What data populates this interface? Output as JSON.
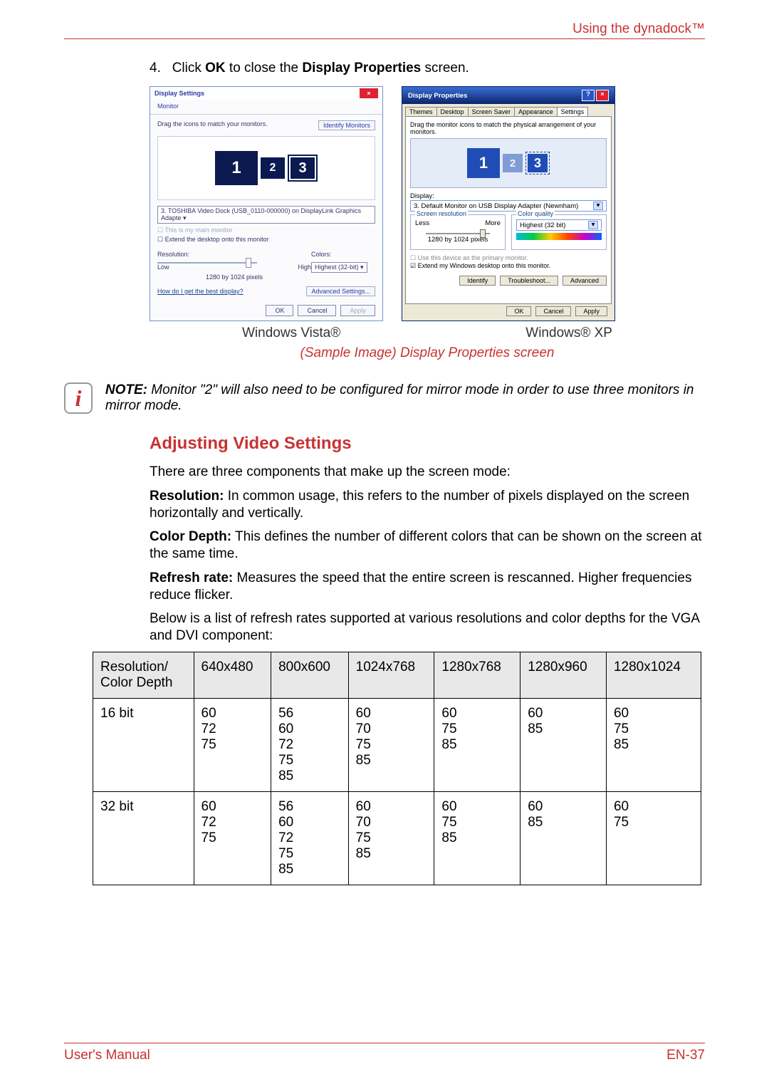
{
  "header": {
    "right": "Using the dynadock™"
  },
  "step": {
    "num": "4.",
    "text_pre": "Click ",
    "bold1": "OK",
    "mid": " to close the ",
    "bold2": "Display Properties",
    "text_post": " screen."
  },
  "vista": {
    "title": "Display Settings",
    "sub": "Monitor",
    "arrange_text": "Drag the icons to match your monitors.",
    "identify": "Identify Monitors",
    "m1": "1",
    "m2": "2",
    "m3": "3",
    "device_dd": "3. TOSHIBA Video Dock (USB_0110-000000) on DisplayLink Graphics Adapte  ▾",
    "cb_main": "This is my main monitor",
    "cb_extend": "Extend the desktop onto this monitor",
    "res_label": "Resolution:",
    "colors_label": "Colors:",
    "low": "Low",
    "high": "High",
    "colors_val": "Highest (32-bit)   ▾",
    "res_val": "1280 by 1024 pixels",
    "help": "How do I get the best display?",
    "adv": "Advanced Settings...",
    "ok": "OK",
    "cancel": "Cancel",
    "apply": "Apply"
  },
  "xp": {
    "title": "Display Properties",
    "tabs": [
      "Themes",
      "Desktop",
      "Screen Saver",
      "Appearance",
      "Settings"
    ],
    "drag": "Drag the monitor icons to match the physical arrangement of your monitors.",
    "m1": "1",
    "m2": "2",
    "m3": "3",
    "display_label": "Display:",
    "display_val": "3. Default Monitor on USB Display Adapter (Newnham)",
    "res_label": "Screen resolution",
    "cq_label": "Color quality",
    "less": "Less",
    "more": "More",
    "res_val": "1280 by 1024 pixels",
    "cq_val": "Highest (32 bit)",
    "cb_primary": "Use this device as the primary monitor.",
    "cb_extend": "Extend my Windows desktop onto this monitor.",
    "identify": "Identify",
    "trouble": "Troubleshoot...",
    "adv": "Advanced",
    "ok": "OK",
    "cancel": "Cancel",
    "apply": "Apply"
  },
  "captions": {
    "vista": "Windows Vista®",
    "xp": "Windows® XP",
    "sample": "(Sample Image) Display Properties screen"
  },
  "note": {
    "label": "NOTE:",
    "body": " Monitor \"2\" will also need to be configured for mirror mode in order to use three monitors in mirror mode."
  },
  "section_heading": "Adjusting Video Settings",
  "paras": {
    "intro": "There are three components that make up the screen mode:",
    "res_b": "Resolution:",
    "res": " In common usage, this refers to the number of pixels displayed on the screen horizontally and vertically.",
    "cd_b": "Color Depth:",
    "cd": " This defines the number of different colors that can be shown on the screen at the same time.",
    "rr_b": "Refresh rate:",
    "rr": " Measures the speed that the entire screen is rescanned. Higher frequencies reduce flicker.",
    "below": "Below is a list of refresh rates supported at various resolutions and color depths for the VGA and DVI component:"
  },
  "table": {
    "headers": [
      "Resolution/\nColor Depth",
      "640x480",
      "800x600",
      "1024x768",
      "1280x768",
      "1280x960",
      "1280x1024"
    ],
    "rows": [
      {
        "label": "16 bit",
        "cells": [
          "60\n72\n75",
          "56\n60\n72\n75\n85",
          "60\n70\n75\n85",
          "60\n75\n85",
          "60\n85",
          "60\n75\n85"
        ]
      },
      {
        "label": "32 bit",
        "cells": [
          "60\n72\n75",
          "56\n60\n72\n75\n85",
          "60\n70\n75\n85",
          "60\n75\n85",
          "60\n85",
          "60\n75"
        ]
      }
    ]
  },
  "footer": {
    "left": "User's Manual",
    "right": "EN-37"
  }
}
